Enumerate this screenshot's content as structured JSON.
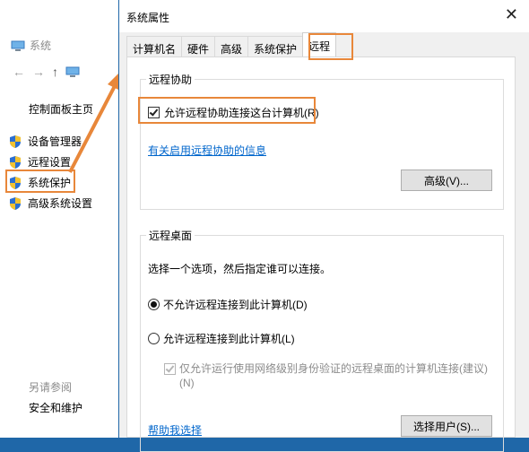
{
  "bg_window": {
    "title": "系统",
    "home_link": "控制面板主页",
    "links": [
      "设备管理器",
      "远程设置",
      "系统保护",
      "高级系统设置"
    ],
    "see_also": "另请参阅",
    "security": "安全和维护"
  },
  "dialog": {
    "title": "系统属性",
    "close": "✕",
    "tabs": [
      "计算机名",
      "硬件",
      "高级",
      "系统保护",
      "远程"
    ],
    "active_tab": "远程",
    "assist": {
      "legend": "远程协助",
      "checkbox_label": "允许远程协助连接这台计算机(R)",
      "checked": true,
      "info_link": "有关启用远程协助的信息",
      "advanced_button": "高级(V)..."
    },
    "desktop": {
      "legend": "远程桌面",
      "instruction": "选择一个选项，然后指定谁可以连接。",
      "option_deny": "不允许远程连接到此计算机(D)",
      "option_allow": "允许远程连接到此计算机(L)",
      "selected": "option_deny",
      "nla_label": "仅允许运行使用网络级别身份验证的远程桌面的计算机连接(建议)",
      "nla_suffix": "(N)",
      "help_link": "帮助我选择",
      "select_users_button": "选择用户(S)..."
    }
  },
  "colors": {
    "highlight": "#e8873a",
    "link": "#0066cc",
    "desktop_bg": "#1f67a8"
  }
}
